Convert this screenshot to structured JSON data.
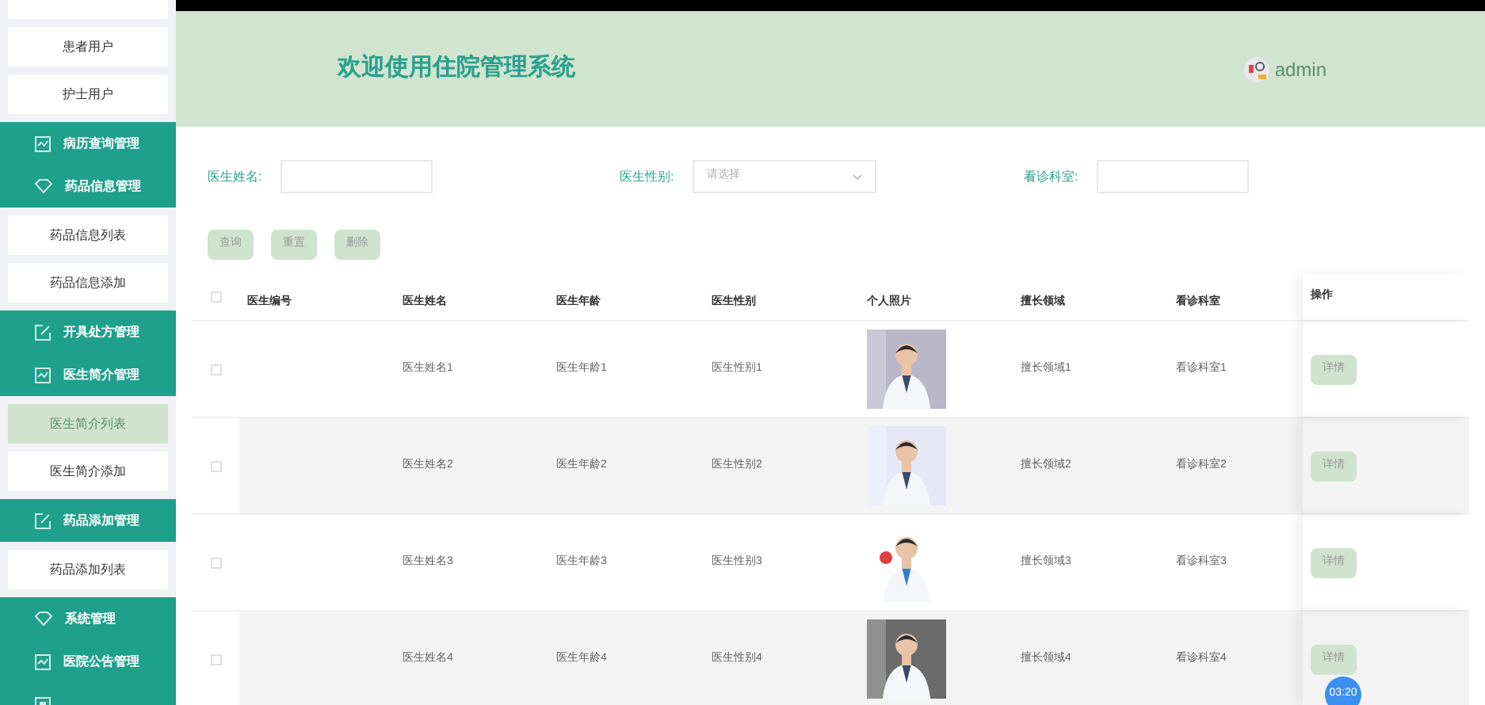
{
  "sidebar": {
    "items": [
      {
        "kind": "stub",
        "selected": false
      },
      {
        "kind": "item",
        "label": "患者用户",
        "selected": false
      },
      {
        "kind": "item",
        "label": "护士用户",
        "selected": false
      },
      {
        "kind": "group",
        "label": "病历查询管理"
      },
      {
        "kind": "group",
        "label": "药品信息管理"
      },
      {
        "kind": "item",
        "label": "药品信息列表",
        "selected": false
      },
      {
        "kind": "item",
        "label": "药品信息添加",
        "selected": false
      },
      {
        "kind": "group",
        "label": "开具处方管理"
      },
      {
        "kind": "group",
        "label": "医生简介管理"
      },
      {
        "kind": "item",
        "label": "医生简介列表",
        "selected": true
      },
      {
        "kind": "item",
        "label": "医生简介添加",
        "selected": false
      },
      {
        "kind": "group",
        "label": "药品添加管理"
      },
      {
        "kind": "item",
        "label": "药品添加列表",
        "selected": false
      },
      {
        "kind": "group",
        "label": "系统管理"
      },
      {
        "kind": "group",
        "label": "医院公告管理"
      },
      {
        "kind": "group"
      }
    ]
  },
  "header": {
    "title": "欢迎使用住院管理系统",
    "user": "admin"
  },
  "filters": [
    {
      "kind": "input",
      "label": "医生姓名:"
    },
    {
      "kind": "select",
      "label": "医生性别:",
      "placeholder": "请选择"
    },
    {
      "kind": "input",
      "label": "看诊科室:"
    }
  ],
  "buttons": [
    "查询",
    "重置",
    "删除"
  ],
  "table": {
    "header_checked": false,
    "columns": [
      "医生编号",
      "医生姓名",
      "医生年龄",
      "医生性别",
      "个人照片",
      "擅长领域",
      "看诊科室",
      "操作"
    ],
    "rows": [
      {
        "checked": false,
        "name": "医生姓名1",
        "age": "医生年龄1",
        "gender": "医生性别1",
        "specialty": "擅长领域1",
        "department": "看诊科室1",
        "action": "详情"
      },
      {
        "checked": false,
        "name": "医生姓名2",
        "age": "医生年龄2",
        "gender": "医生性别2",
        "specialty": "擅长领域2",
        "department": "看诊科室2",
        "action": "详情"
      },
      {
        "checked": false,
        "name": "医生姓名3",
        "age": "医生年龄3",
        "gender": "医生性别3",
        "specialty": "擅长领域3",
        "department": "看诊科室3",
        "action": "详情"
      },
      {
        "checked": false,
        "name": "医生姓名4",
        "age": "医生年龄4",
        "gender": "医生性别4",
        "specialty": "擅长领域4",
        "department": "看诊科室4",
        "action": "详情"
      }
    ]
  },
  "timer": "03:20"
}
